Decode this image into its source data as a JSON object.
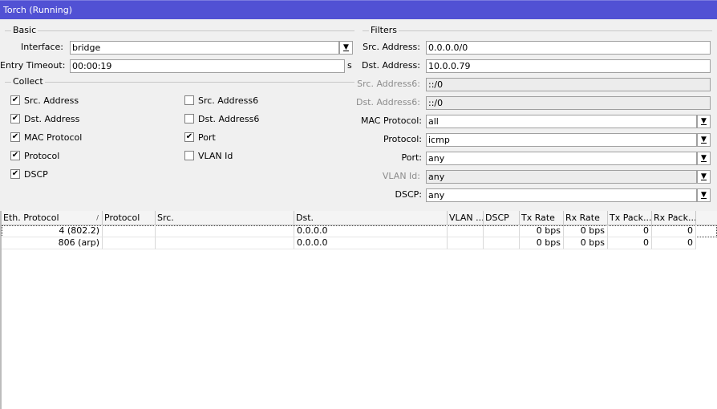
{
  "window": {
    "title": "Torch (Running)"
  },
  "basic": {
    "group_label": "Basic",
    "interface_label": "Interface:",
    "interface_value": "bridge",
    "entry_timeout_label": "Entry Timeout:",
    "entry_timeout_value": "00:00:19",
    "entry_timeout_unit": "s"
  },
  "collect": {
    "group_label": "Collect",
    "items": [
      {
        "label": "Src. Address",
        "checked": true
      },
      {
        "label": "Dst. Address",
        "checked": true
      },
      {
        "label": "MAC Protocol",
        "checked": true
      },
      {
        "label": "Protocol",
        "checked": true
      },
      {
        "label": "DSCP",
        "checked": true
      },
      {
        "label": "Src. Address6",
        "checked": false
      },
      {
        "label": "Dst. Address6",
        "checked": false
      },
      {
        "label": "Port",
        "checked": true
      },
      {
        "label": "VLAN Id",
        "checked": false
      }
    ]
  },
  "filters": {
    "group_label": "Filters",
    "fields": [
      {
        "label": "Src. Address:",
        "value": "0.0.0.0/0",
        "disabled": false,
        "dropdown": false
      },
      {
        "label": "Dst. Address:",
        "value": "10.0.0.79",
        "disabled": false,
        "dropdown": false
      },
      {
        "label": "Src. Address6:",
        "value": "::/0",
        "disabled": true,
        "dropdown": false
      },
      {
        "label": "Dst. Address6:",
        "value": "::/0",
        "disabled": true,
        "dropdown": false
      },
      {
        "label": "MAC Protocol:",
        "value": "all",
        "disabled": false,
        "dropdown": true
      },
      {
        "label": "Protocol:",
        "value": "icmp",
        "disabled": false,
        "dropdown": true
      },
      {
        "label": "Port:",
        "value": "any",
        "disabled": false,
        "dropdown": true
      },
      {
        "label": "VLAN Id:",
        "value": "any",
        "disabled": true,
        "dropdown": true
      },
      {
        "label": "DSCP:",
        "value": "any",
        "disabled": false,
        "dropdown": true
      }
    ]
  },
  "table": {
    "columns": [
      "Eth. Protocol",
      "Protocol",
      "Src.",
      "Dst.",
      "VLAN ...",
      "DSCP",
      "Tx Rate",
      "Rx Rate",
      "Tx Pack...",
      "Rx Pack..."
    ],
    "sort_indicator": "/",
    "rows": [
      [
        "4 (802.2)",
        "",
        "",
        "0.0.0.0",
        "",
        "",
        "0 bps",
        "0 bps",
        "0",
        "0"
      ],
      [
        "806 (arp)",
        "",
        "",
        "0.0.0.0",
        "",
        "",
        "0 bps",
        "0 bps",
        "0",
        "0"
      ]
    ]
  },
  "colors": {
    "titlebar": "#5151d4",
    "panel": "#f0f0f0",
    "field_bg": "#ffffff"
  },
  "icons": {
    "dropdown": "dropdown-arrow-icon",
    "check": "checkmark-icon"
  }
}
